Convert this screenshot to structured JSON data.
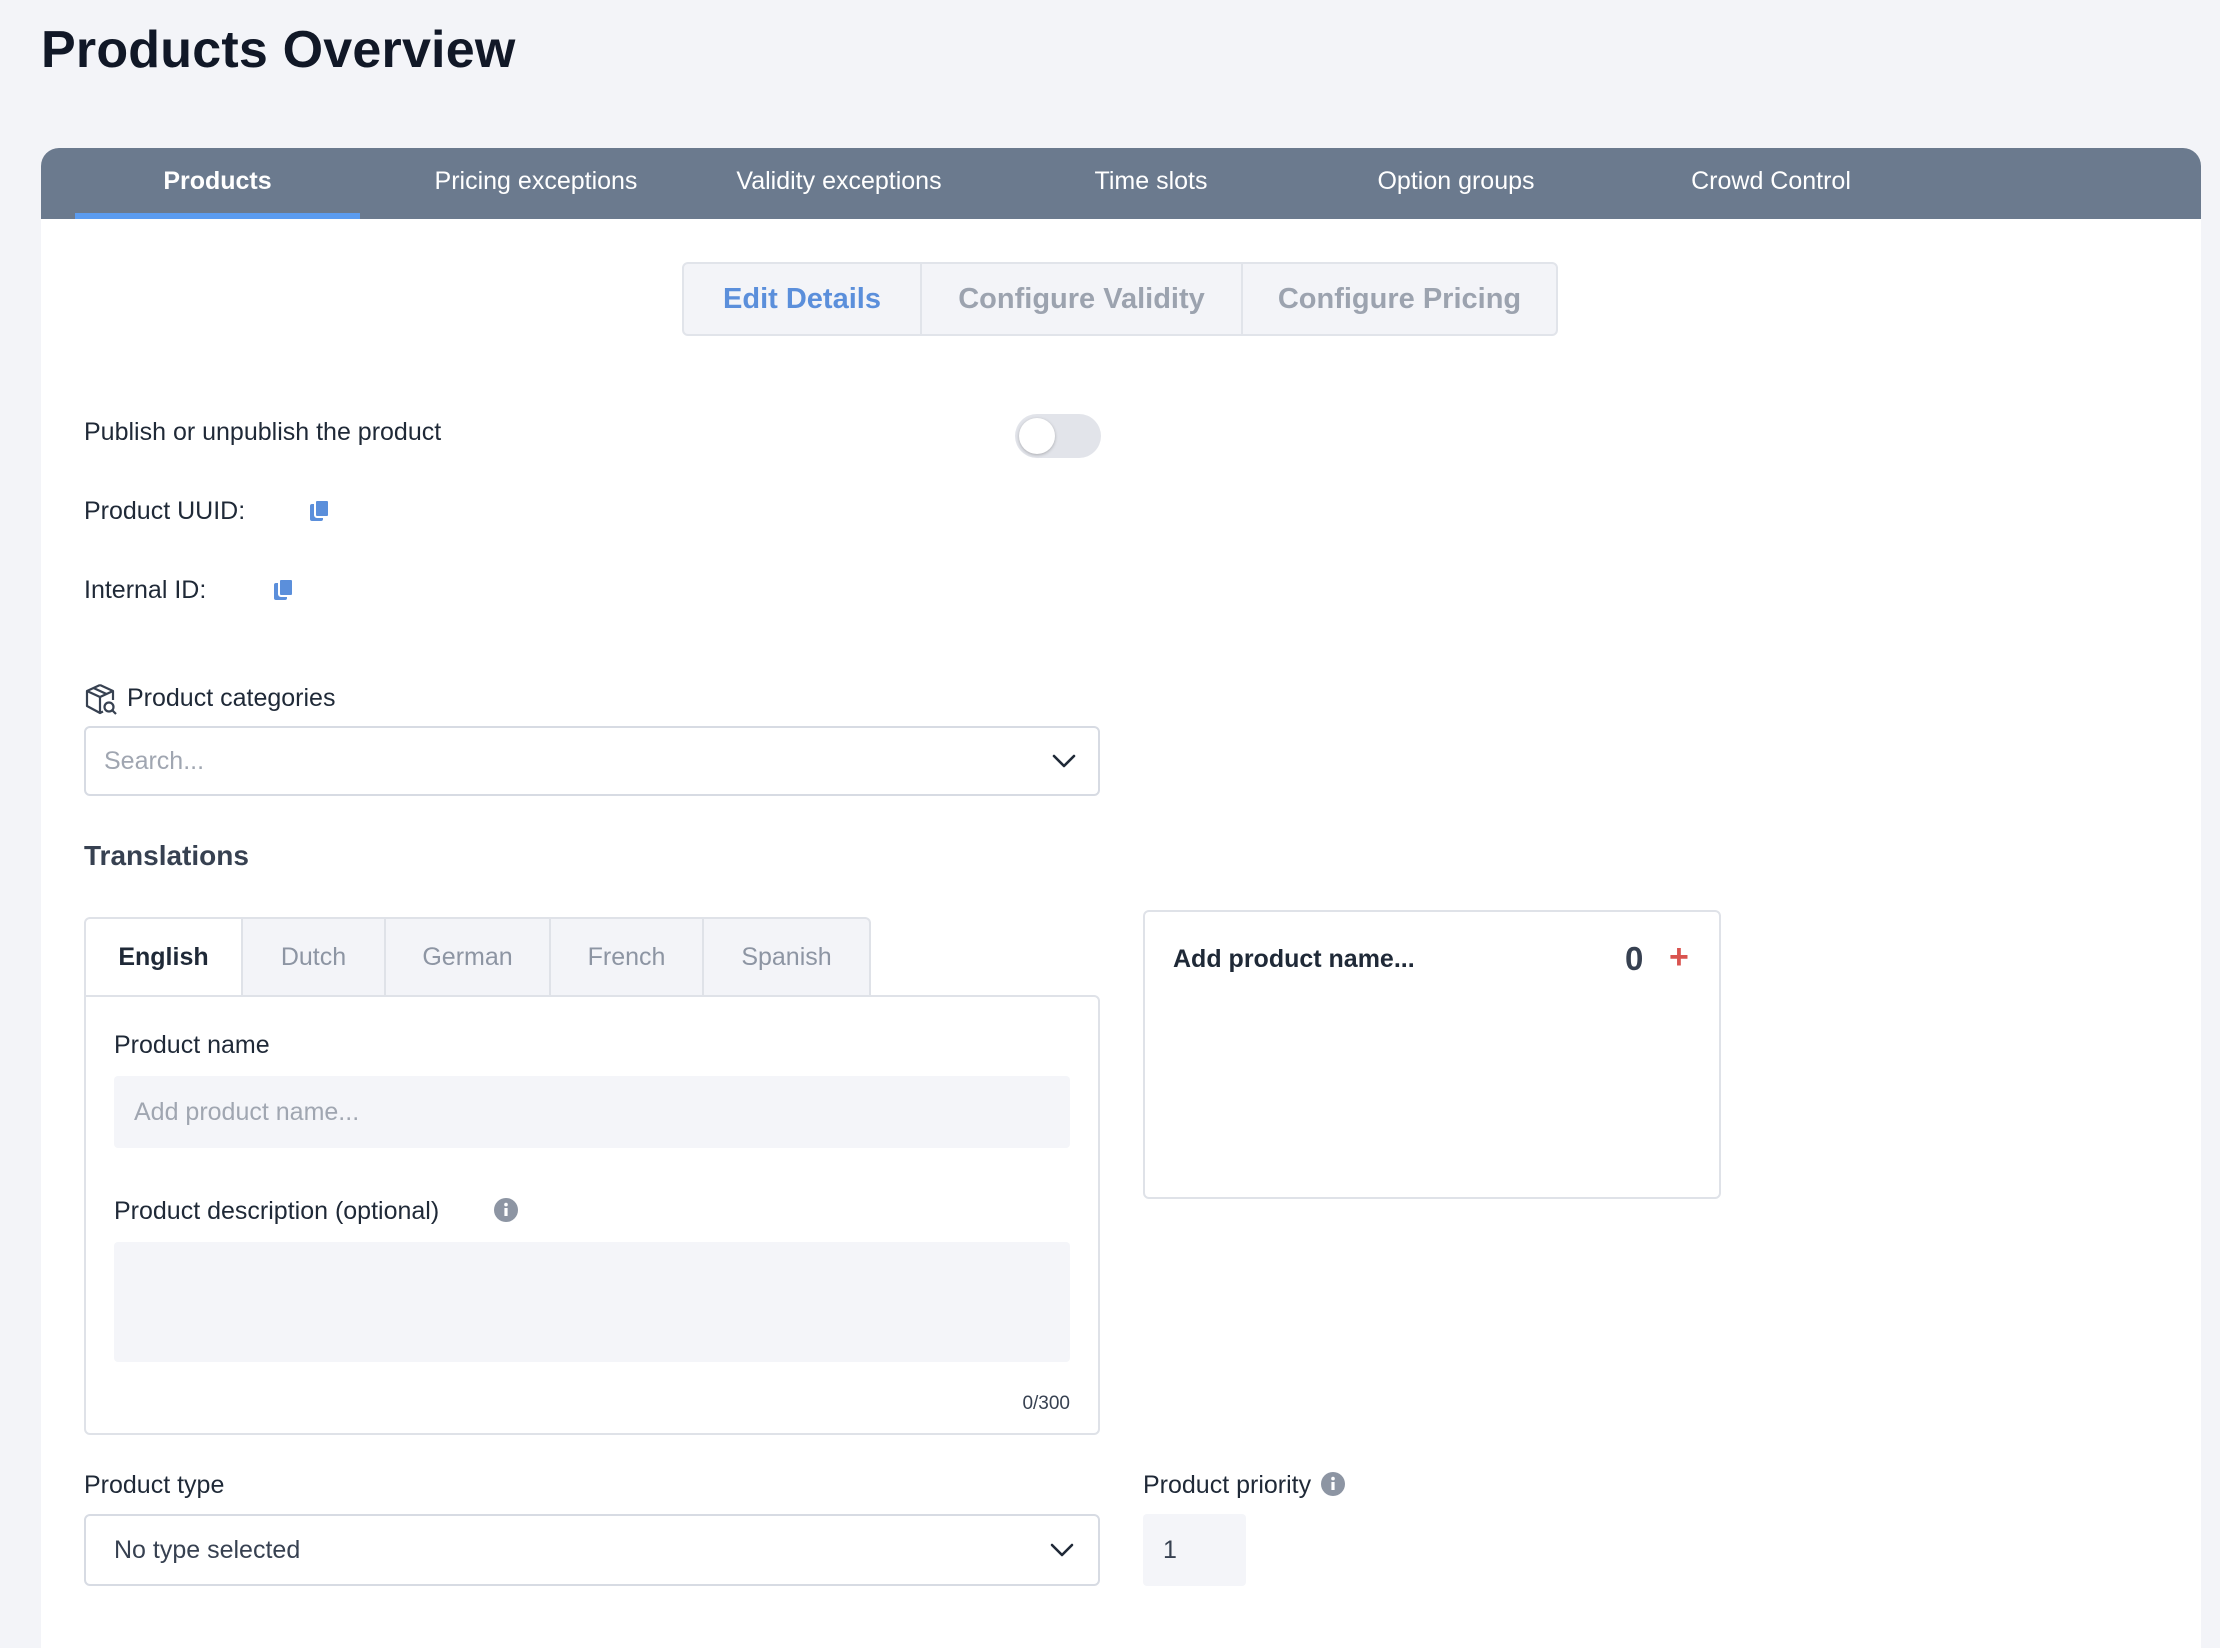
{
  "page": {
    "title": "Products Overview"
  },
  "main_tabs": [
    {
      "label": "Products",
      "active": true
    },
    {
      "label": "Pricing exceptions",
      "active": false
    },
    {
      "label": "Validity exceptions",
      "active": false
    },
    {
      "label": "Time slots",
      "active": false
    },
    {
      "label": "Option groups",
      "active": false
    },
    {
      "label": "Crowd Control",
      "active": false
    }
  ],
  "sub_tabs": [
    {
      "label": "Edit Details",
      "active": true
    },
    {
      "label": "Configure Validity",
      "active": false
    },
    {
      "label": "Configure Pricing",
      "active": false
    }
  ],
  "publish": {
    "label": "Publish or unpublish the product",
    "enabled": false
  },
  "product_uuid": {
    "label": "Product UUID:",
    "icon": "copy-icon"
  },
  "internal_id": {
    "label": "Internal ID:",
    "icon": "copy-icon"
  },
  "categories": {
    "label": "Product categories",
    "icon": "box-search-icon",
    "placeholder": "Search..."
  },
  "translations": {
    "title": "Translations",
    "languages": [
      {
        "label": "English",
        "active": true
      },
      {
        "label": "Dutch",
        "active": false
      },
      {
        "label": "German",
        "active": false
      },
      {
        "label": "French",
        "active": false
      },
      {
        "label": "Spanish",
        "active": false
      }
    ],
    "product_name_label": "Product name",
    "product_name_placeholder": "Add product name...",
    "description_label": "Product description (optional)",
    "char_count": "0/300"
  },
  "preview": {
    "name": "Add product name...",
    "count": "0",
    "add_symbol": "+"
  },
  "product_type": {
    "label": "Product type",
    "value": "No type selected"
  },
  "product_priority": {
    "label": "Product priority",
    "value": "1"
  },
  "colors": {
    "accent": "#5b9cf0",
    "tabbar": "#6b7a8e",
    "add": "#d9534f",
    "background": "#f3f4f8"
  }
}
